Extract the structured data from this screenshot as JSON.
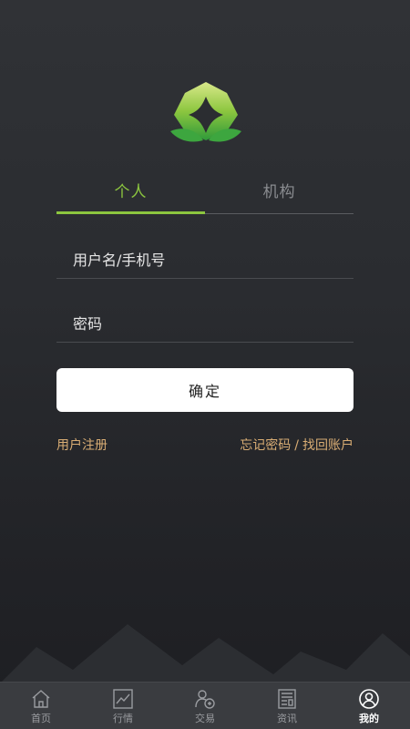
{
  "login": {
    "tabs": [
      {
        "label": "个人",
        "active": true
      },
      {
        "label": "机构",
        "active": false
      }
    ],
    "username_placeholder": "用户名/手机号",
    "password_placeholder": "密码",
    "confirm_label": "确定",
    "register_label": "用户注册",
    "forgot_password_label": "忘记密码",
    "separator": "/",
    "recover_account_label": "找回账户"
  },
  "bottom_nav": {
    "items": [
      {
        "label": "首页",
        "icon": "home-icon",
        "active": false
      },
      {
        "label": "行情",
        "icon": "chart-icon",
        "active": false
      },
      {
        "label": "交易",
        "icon": "trade-icon",
        "active": false
      },
      {
        "label": "资讯",
        "icon": "news-icon",
        "active": false
      },
      {
        "label": "我的",
        "icon": "user-icon",
        "active": true
      }
    ]
  },
  "colors": {
    "accent_green": "#8cc63f",
    "link_gold": "#d9ad74",
    "background": "#2a2c30"
  }
}
